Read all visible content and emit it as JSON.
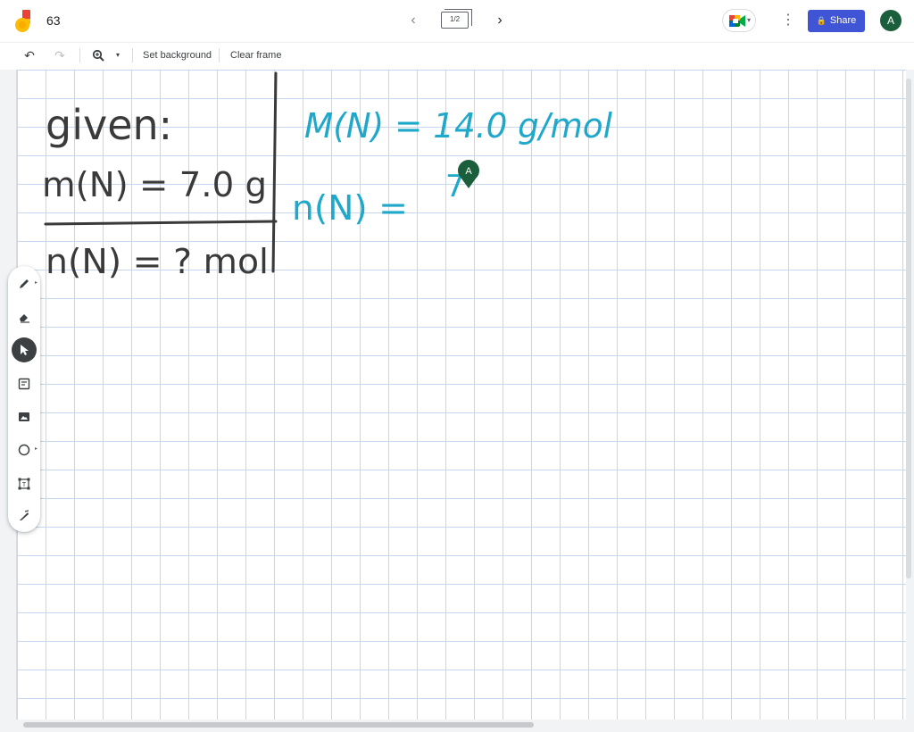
{
  "header": {
    "title": "63",
    "frame_counter": "1/2",
    "share_label": "Share",
    "avatar_initial": "A"
  },
  "toolbar": {
    "set_background": "Set background",
    "clear_frame": "Clear frame"
  },
  "whiteboard": {
    "given_label": "given:",
    "given_mass": "m(N) = 7.0 g",
    "unknown": "n(N) = ? mol",
    "molar_mass": "M(N) = 14.0 g/mol",
    "moles_expr": "n(N) =",
    "partial_digit": "7",
    "collaborator_initial": "A"
  },
  "colors": {
    "brand_blue": "#4054d6",
    "avatar_green": "#1b5e3b",
    "ink_dark": "#3a3a3a",
    "ink_teal": "#1fa8c9",
    "grid": "#c4d7ee"
  },
  "icons": [
    "jamboard-logo-icon",
    "chevron-left-icon",
    "chevron-right-icon",
    "meet-icon",
    "more-vert-icon",
    "lock-icon",
    "undo-icon",
    "redo-icon",
    "zoom-icon",
    "pen-icon",
    "eraser-icon",
    "select-icon",
    "sticky-note-icon",
    "image-icon",
    "circle-icon",
    "text-box-icon",
    "laser-icon"
  ]
}
